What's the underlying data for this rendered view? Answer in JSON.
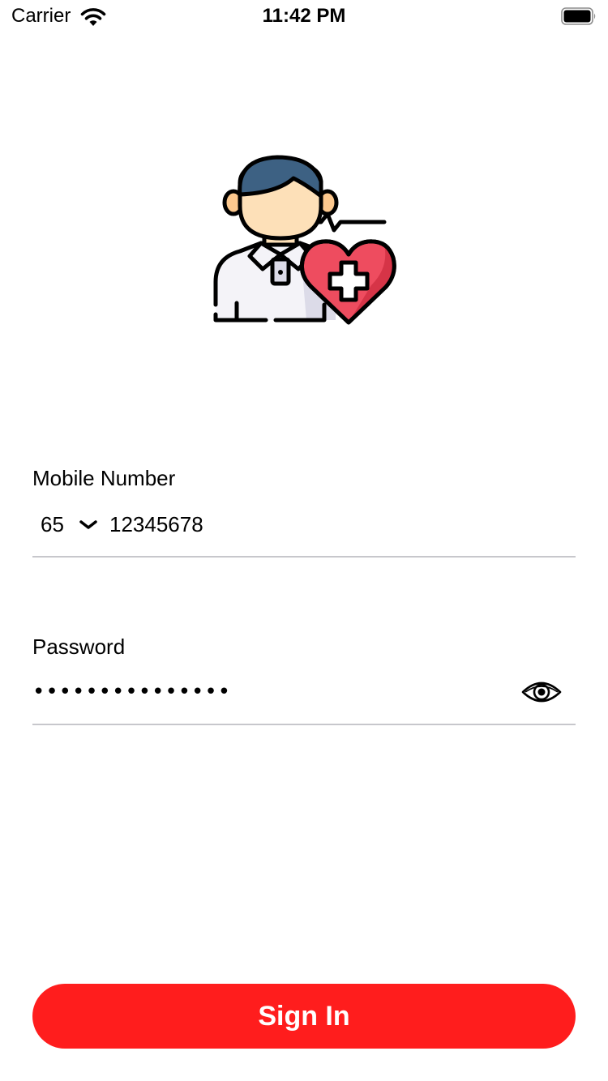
{
  "status_bar": {
    "carrier": "Carrier",
    "time": "11:42 PM",
    "wifi_icon": "wifi-icon",
    "battery_icon": "battery-icon"
  },
  "hero": {
    "icon": "doctor-heart-icon",
    "colors": {
      "hair": "#3d6183",
      "skin": "#fde0b8",
      "shirt": "#f4f3f8",
      "shirt_shade": "#dcdbe8",
      "heart": "#ee4c5f",
      "heart_shade": "#d63447",
      "outline": "#000000"
    }
  },
  "form": {
    "mobile": {
      "label": "Mobile Number",
      "country_code": "65",
      "value": "12345678"
    },
    "password": {
      "label": "Password",
      "value": "•••••••••••••••"
    }
  },
  "sign_in": {
    "label": "Sign In",
    "color": "#ff1d1d"
  },
  "colors": {
    "divider": "#c7c7cc",
    "background": "#ffffff"
  }
}
